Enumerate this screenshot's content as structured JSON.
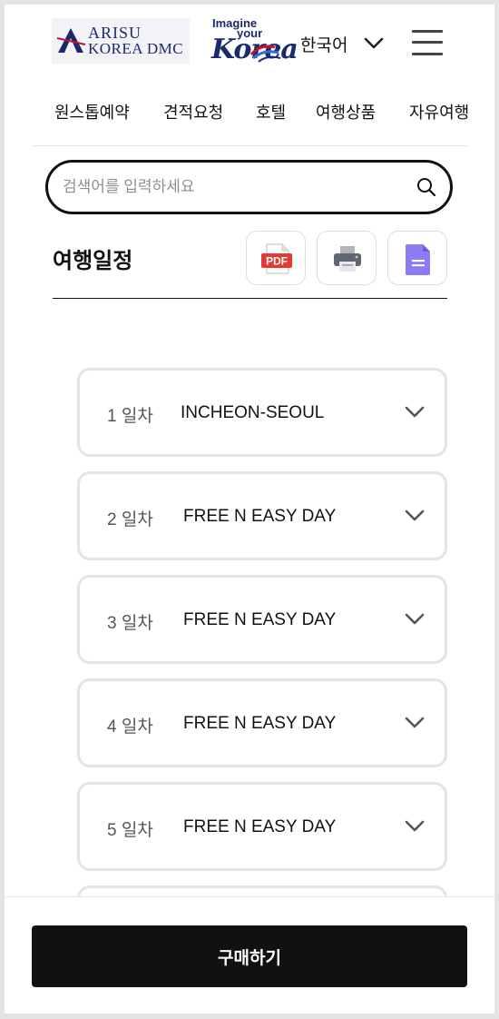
{
  "header": {
    "logo_arisu": {
      "line1": "ARISU",
      "line2": "KOREA DMC"
    },
    "logo_korea": {
      "line1": "Imagine",
      "line2": "your",
      "line3": "Korea"
    },
    "language": "한국어",
    "icons": {
      "language": "chevron-down-icon",
      "menu": "hamburger-menu-icon"
    }
  },
  "nav": {
    "items": [
      {
        "label": "원스톱예약"
      },
      {
        "label": "견적요청"
      },
      {
        "label": "호텔"
      },
      {
        "label": "여행상품"
      },
      {
        "label": "자유여행"
      }
    ]
  },
  "search": {
    "value": "",
    "placeholder": "검색어를 입력하세요",
    "icon": "search-icon"
  },
  "itinerary": {
    "title": "여행일정",
    "tools": [
      {
        "name": "pdf-icon",
        "label": "PDF"
      },
      {
        "name": "print-icon"
      },
      {
        "name": "document-icon"
      }
    ],
    "days": [
      {
        "day": "1 일차",
        "title": "INCHEON-SEOUL"
      },
      {
        "day": "2 일차",
        "title": "FREE N EASY DAY"
      },
      {
        "day": "3 일차",
        "title": "FREE N EASY DAY"
      },
      {
        "day": "4 일차",
        "title": "FREE N EASY DAY"
      },
      {
        "day": "5 일차",
        "title": "FREE N EASY DAY"
      }
    ]
  },
  "footer": {
    "buy_label": "구매하기"
  },
  "colors": {
    "brand_navy": "#1b2a6b",
    "button_dark": "#111111",
    "card_border": "#e3e3ec",
    "pdf_red": "#e53935",
    "doc_purple": "#8b7cf6"
  }
}
